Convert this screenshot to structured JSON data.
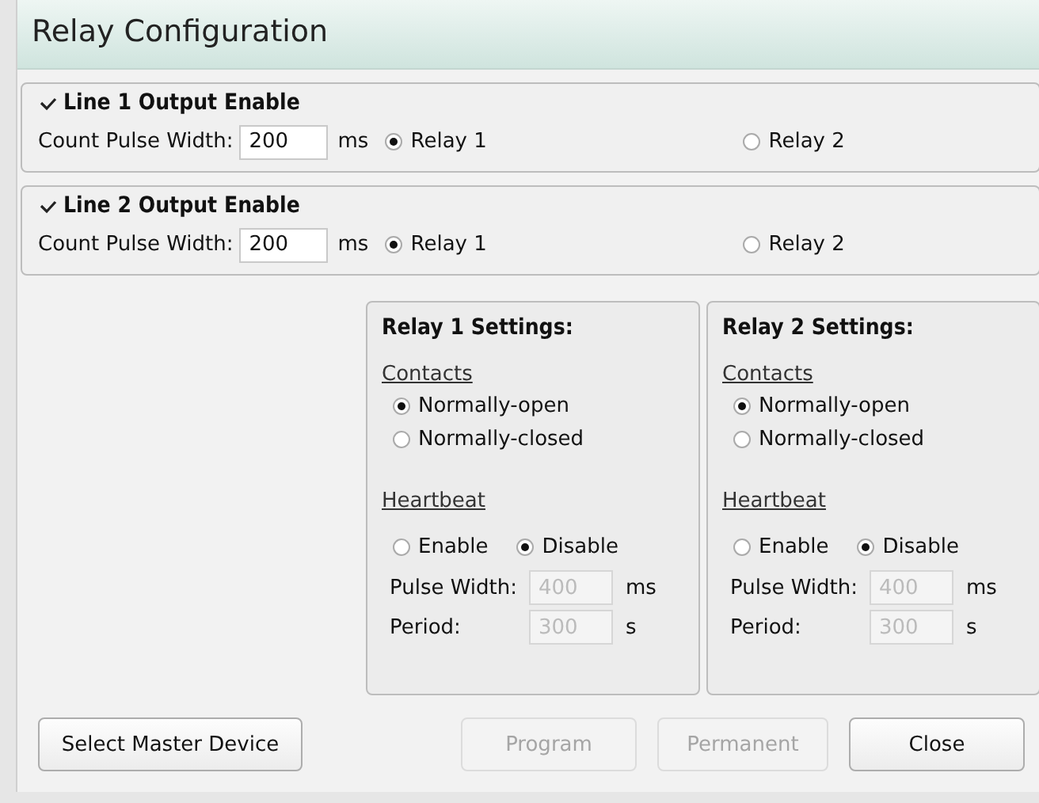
{
  "window": {
    "title": "Relay Configuration"
  },
  "lines": [
    {
      "label": "Line 1 Output Enable",
      "checked": true,
      "pulse_label": "Count Pulse Width:",
      "pulse_value": "200",
      "unit": "ms",
      "relays": [
        {
          "label": "Relay 1",
          "selected": true
        },
        {
          "label": "Relay 2",
          "selected": false
        }
      ]
    },
    {
      "label": "Line 2 Output Enable",
      "checked": true,
      "pulse_label": "Count Pulse Width:",
      "pulse_value": "200",
      "unit": "ms",
      "relays": [
        {
          "label": "Relay 1",
          "selected": true
        },
        {
          "label": "Relay 2",
          "selected": false
        }
      ]
    }
  ],
  "relay_settings": [
    {
      "title": "Relay 1 Settings:",
      "contacts_label": "Contacts",
      "contacts": [
        {
          "label": "Normally-open",
          "selected": true
        },
        {
          "label": "Normally-closed",
          "selected": false
        }
      ],
      "heartbeat_label": "Heartbeat",
      "heartbeat": [
        {
          "label": "Enable",
          "selected": false
        },
        {
          "label": "Disable",
          "selected": true
        }
      ],
      "pulse_width": {
        "label": "Pulse Width:",
        "value": "400",
        "unit": "ms",
        "disabled": true
      },
      "period": {
        "label": "Period:",
        "value": "300",
        "unit": "s",
        "disabled": true
      }
    },
    {
      "title": "Relay 2 Settings:",
      "contacts_label": "Contacts",
      "contacts": [
        {
          "label": "Normally-open",
          "selected": true
        },
        {
          "label": "Normally-closed",
          "selected": false
        }
      ],
      "heartbeat_label": "Heartbeat",
      "heartbeat": [
        {
          "label": "Enable",
          "selected": false
        },
        {
          "label": "Disable",
          "selected": true
        }
      ],
      "pulse_width": {
        "label": "Pulse Width:",
        "value": "400",
        "unit": "ms",
        "disabled": true
      },
      "period": {
        "label": "Period:",
        "value": "300",
        "unit": "s",
        "disabled": true
      }
    }
  ],
  "buttons": [
    {
      "label": "Select Master Device",
      "disabled": false
    },
    {
      "label": "Program",
      "disabled": true
    },
    {
      "label": "Permanent",
      "disabled": true
    },
    {
      "label": "Close",
      "disabled": false
    }
  ]
}
